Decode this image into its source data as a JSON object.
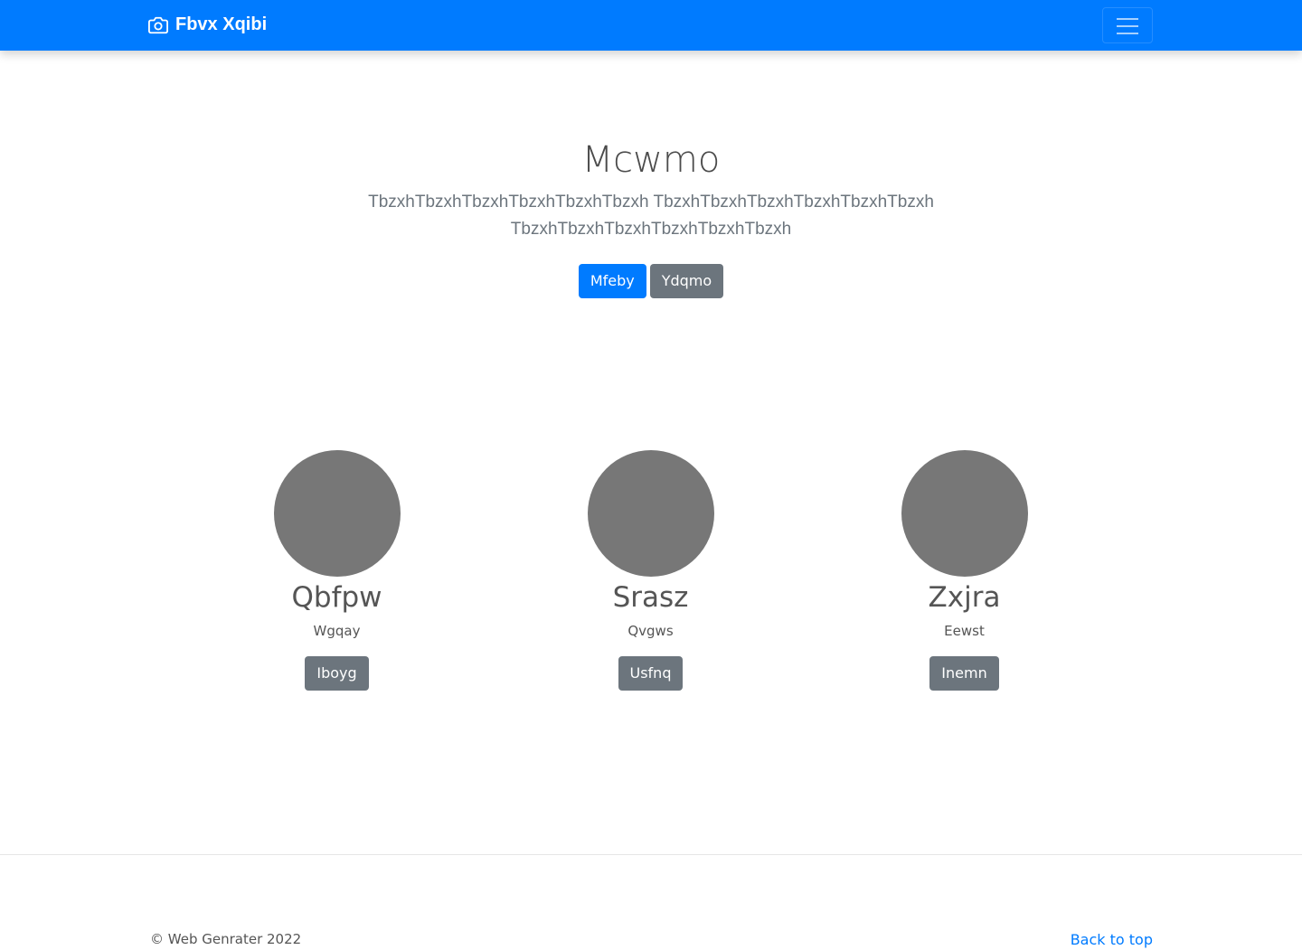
{
  "navbar": {
    "brand_label": "Fbvx Xqibi",
    "brand_icon": "camera-icon",
    "toggler_icon": "menu-icon",
    "background_color": "#007bff"
  },
  "hero": {
    "title": "Mcwmo",
    "lead": "TbzxhTbzxhTbzxhTbzxhTbzxhTbzxh TbzxhTbzxhTbzxhTbzxhTbzxhTbzxh TbzxhTbzxhTbzxhTbzxhTbzxhTbzxh",
    "primary_button": "Mfeby",
    "secondary_button": "Ydqmo"
  },
  "members": [
    {
      "name": "Qbfpw",
      "role": "Wgqay",
      "button": "Iboyg"
    },
    {
      "name": "Srasz",
      "role": "Qvgws",
      "button": "Usfnq"
    },
    {
      "name": "Zxjra",
      "role": "Eewst",
      "button": "Inemn"
    }
  ],
  "footer": {
    "copyright": "© Web Genrater 2022",
    "back_to_top": "Back to top"
  },
  "colors": {
    "primary": "#007bff",
    "secondary": "#6c757d",
    "avatar_placeholder": "#777777"
  }
}
